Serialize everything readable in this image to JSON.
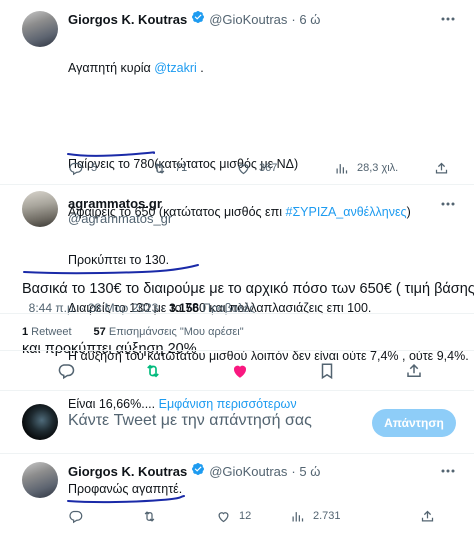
{
  "tweet1": {
    "author_name": "Giorgos K. Koutras",
    "author_handle": "@GioKoutras",
    "time": "· 6 ώ",
    "line1_text": "Αγαπητή κυρία ",
    "line1_mention": "@tzakri",
    "line1_end": " .",
    "line2": "Παίρνεις το 780(κατώτατος μισθός με ΝΔ)",
    "line3_text": "Αφαιρείς το 650 (κατώτατος μισθός επι ",
    "line3_hashtag": "#ΣΥΡΙΖΑ_ανθέλληνες",
    "line3_end": ")",
    "line4": "Προκύπτει το 130.",
    "line5": "Διαιρείς το 130 με το 780 και πολλαπλασιάζεις επι 100.",
    "line6": "Η αύξηση του κατώτατου μισθού λοιπόν δεν είναι ούτε 7,4% , ούτε 9,4%.",
    "line7_text": "Είναι 16,66%....",
    "show_more": " Εμφάνιση περισσότερων",
    "replies": "5",
    "retweets": "71",
    "likes": "367",
    "views": "28,3 χιλ."
  },
  "tweet2": {
    "author_name": "agrammatos.gr",
    "author_handle": "@agrammatos_gr",
    "body_line1": "Βασικά το 130€ το διαιρούμε με το αρχικό πόσο των 650€ ( τιμή βάσης)",
    "body_line2_text": "και προκύπτει ",
    "body_line2_highlight": "αύξηση 20%",
    "datetime": "8:44 π.μ. · 28 Μαρ 2023 · ",
    "views_count": "3.156",
    "views_label": " Προβολές",
    "retweet_count": "1",
    "retweet_label": " Retweet",
    "likes_count": "57",
    "likes_label": " Επισημάνσεις \"Μου αρέσει\""
  },
  "compose": {
    "placeholder": "Κάντε Tweet με την απάντησή σας",
    "reply_button": "Απάντηση"
  },
  "tweet3": {
    "author_name": "Giorgos K. Koutras",
    "author_handle": "@GioKoutras",
    "time": "· 5 ώ",
    "body": "Προφανώς αγαπητέ.",
    "likes": "12",
    "views": "2.731"
  },
  "colors": {
    "accent": "#1d9bf0",
    "retweet_active": "#00ba7c",
    "like_active": "#f91880",
    "annotation_ink": "#1a2aa8"
  }
}
